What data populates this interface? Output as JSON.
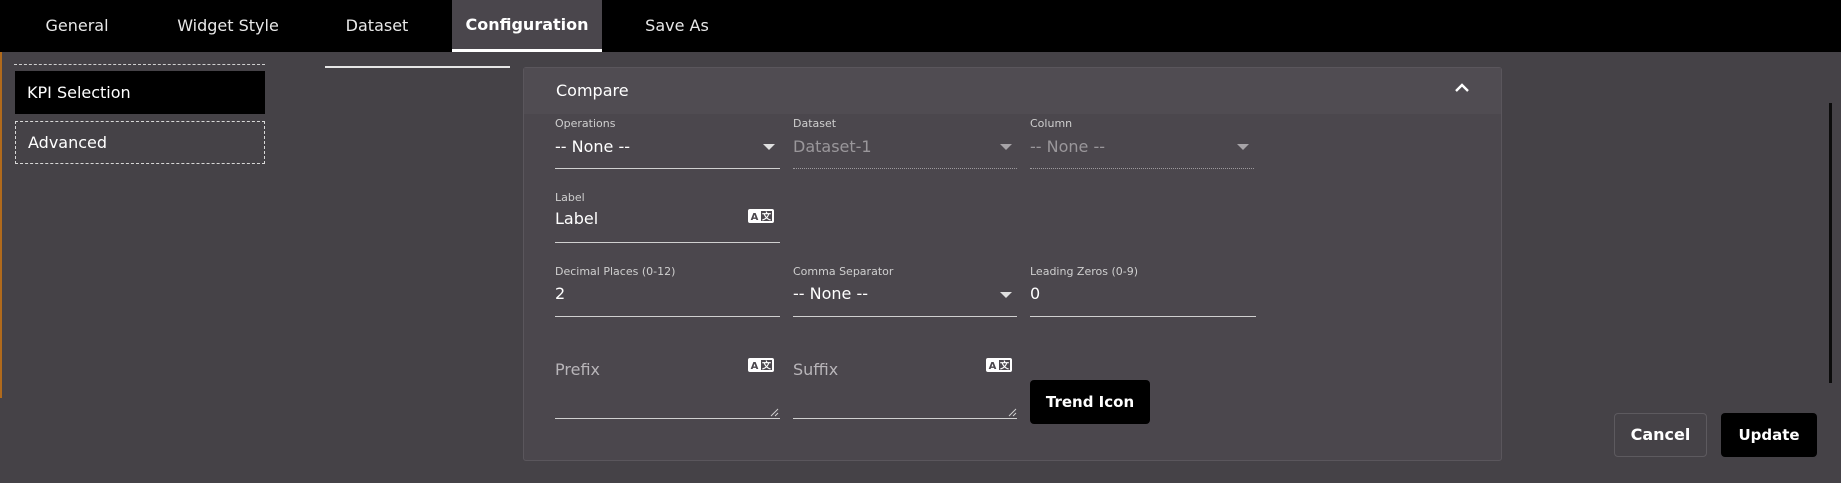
{
  "tabs": [
    {
      "label": "General"
    },
    {
      "label": "Widget Style"
    },
    {
      "label": "Dataset"
    },
    {
      "label": "Configuration",
      "active": true
    },
    {
      "label": "Save As"
    }
  ],
  "sidebar": {
    "items": [
      {
        "label": "KPI Selection",
        "selected": true
      },
      {
        "label": "Advanced"
      }
    ]
  },
  "compare": {
    "title": "Compare",
    "operations": {
      "label": "Operations",
      "value": "-- None --"
    },
    "dataset": {
      "label": "Dataset",
      "value": "Dataset-1"
    },
    "column": {
      "label": "Column",
      "value": "-- None --"
    },
    "label_field": {
      "label": "Label",
      "value": "Label"
    },
    "decimal_places": {
      "label": "Decimal Places (0-12)",
      "value": "2"
    },
    "comma_separator": {
      "label": "Comma Separator",
      "value": "-- None --"
    },
    "leading_zeros": {
      "label": "Leading Zeros (0-9)",
      "value": "0"
    },
    "prefix": {
      "placeholder": "Prefix"
    },
    "suffix": {
      "placeholder": "Suffix"
    },
    "trend_icon_label": "Trend Icon"
  },
  "footer": {
    "cancel_label": "Cancel",
    "update_label": "Update"
  },
  "icons": [
    "chevron-up-icon",
    "dropdown-caret-icon",
    "translate-icon",
    "resize-handle-icon"
  ],
  "colors": {
    "background": "#454247",
    "topbar": "#000000",
    "active_tab": "#4a464c",
    "accent_strip": "#b06a1c"
  }
}
